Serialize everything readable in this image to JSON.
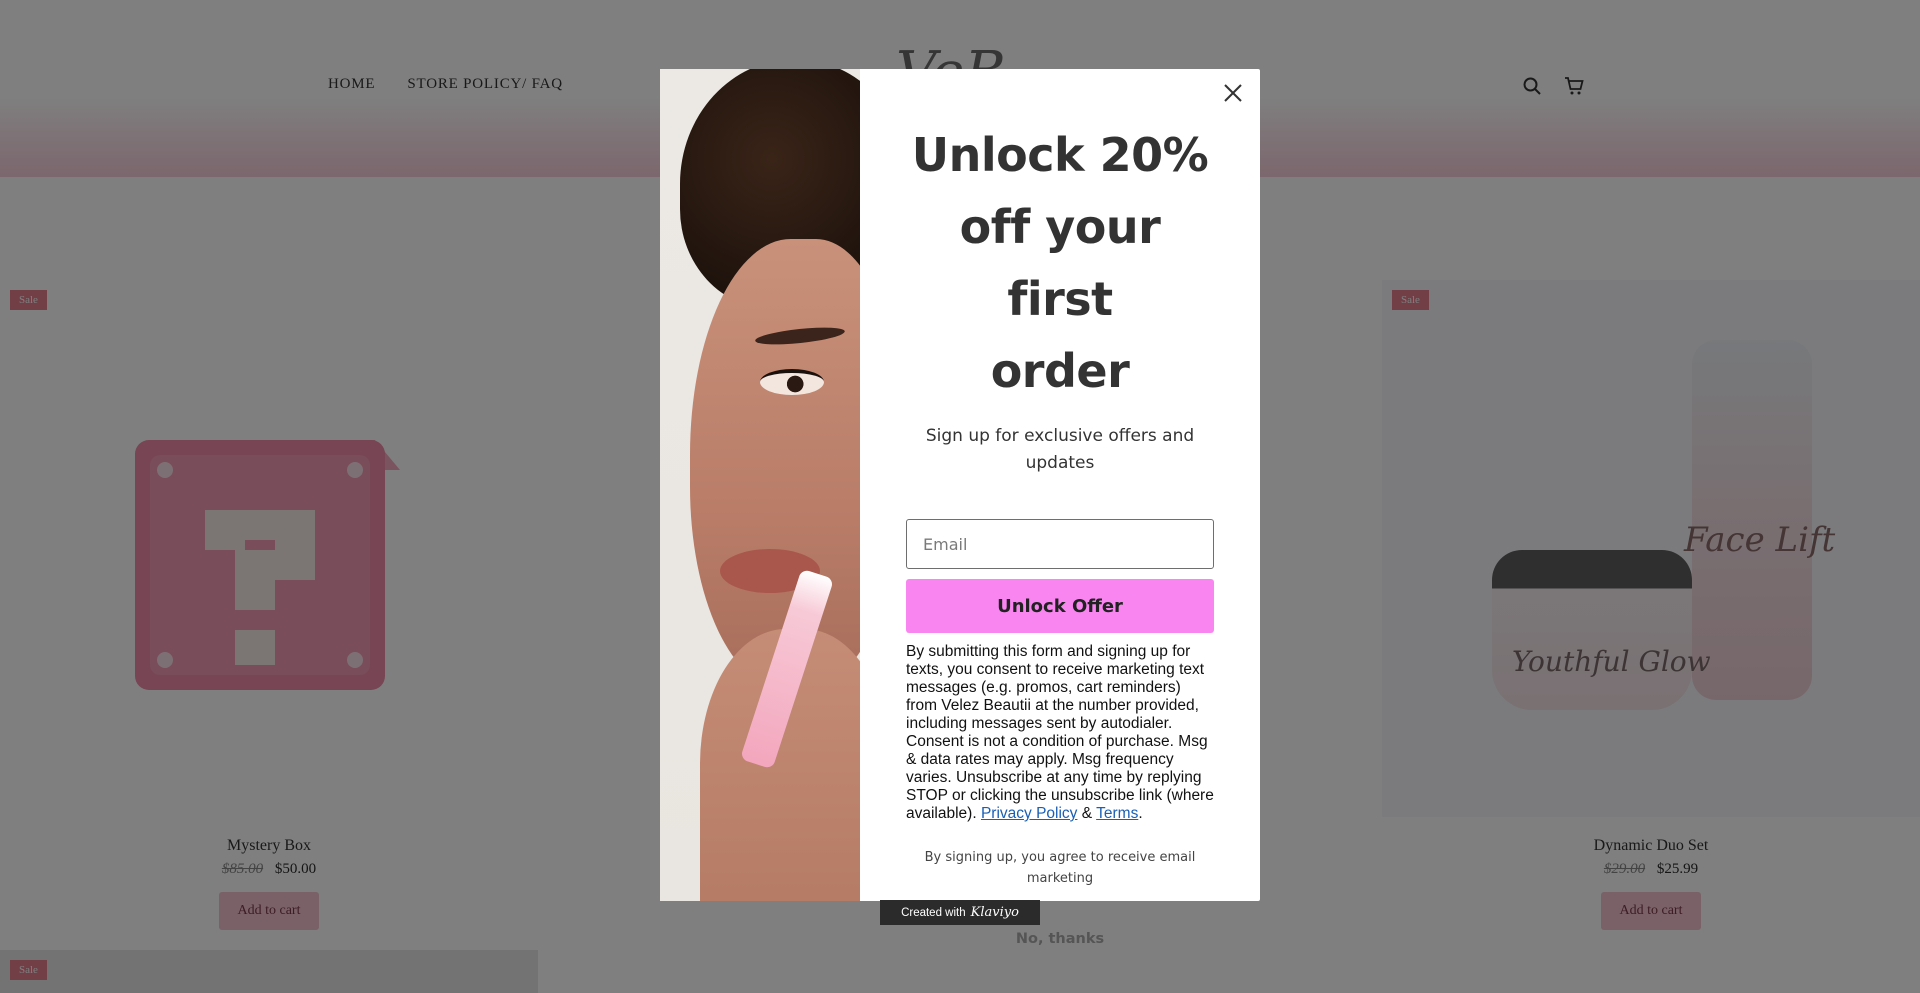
{
  "header": {
    "nav": [
      {
        "label": "HOME"
      },
      {
        "label": "STORE POLICY/ FAQ"
      }
    ],
    "logo_text": "VeB"
  },
  "products": [
    {
      "name": "Mystery Box",
      "old_price": "$85.00",
      "price": "$50.00",
      "badge": "Sale",
      "button": "Add to cart"
    },
    {
      "name": "Dynamic Duo Set",
      "old_price": "$29.00",
      "price": "$25.99",
      "badge": "Sale",
      "button": "Add to cart"
    }
  ],
  "bottom_card": {
    "badge": "Sale"
  },
  "duo_labels": {
    "jar": "Youthful Glow",
    "bottle": "Face Lift"
  },
  "popup": {
    "headline_lines": [
      "Unlock 20%",
      "off your first",
      "order"
    ],
    "subhead": "Sign up for exclusive offers and updates",
    "email_placeholder": "Email",
    "submit_label": "Unlock Offer",
    "legal_text": "By submitting this form and signing up for texts, you consent to receive marketing text messages (e.g. promos, cart reminders) from Velez Beautii at the number provided, including messages sent by autodialer. Consent is not a condition of purchase. Msg & data rates may apply. Msg frequency varies. Unsubscribe at any time by replying STOP or clicking the unsubscribe link (where available).",
    "privacy_link": "Privacy Policy",
    "amp": "&",
    "terms_link": "Terms",
    "period": ".",
    "agree_text": "By signing up, you agree to receive email marketing",
    "dismiss_label": "No, thanks"
  },
  "badge": {
    "prefix": "Created with",
    "brand": "Klaviyo"
  },
  "colors": {
    "accent_button": "#f986f0",
    "header_pink": "#f7cfdb",
    "sale_badge": "#e57e8e",
    "link": "#1a5fb4"
  }
}
